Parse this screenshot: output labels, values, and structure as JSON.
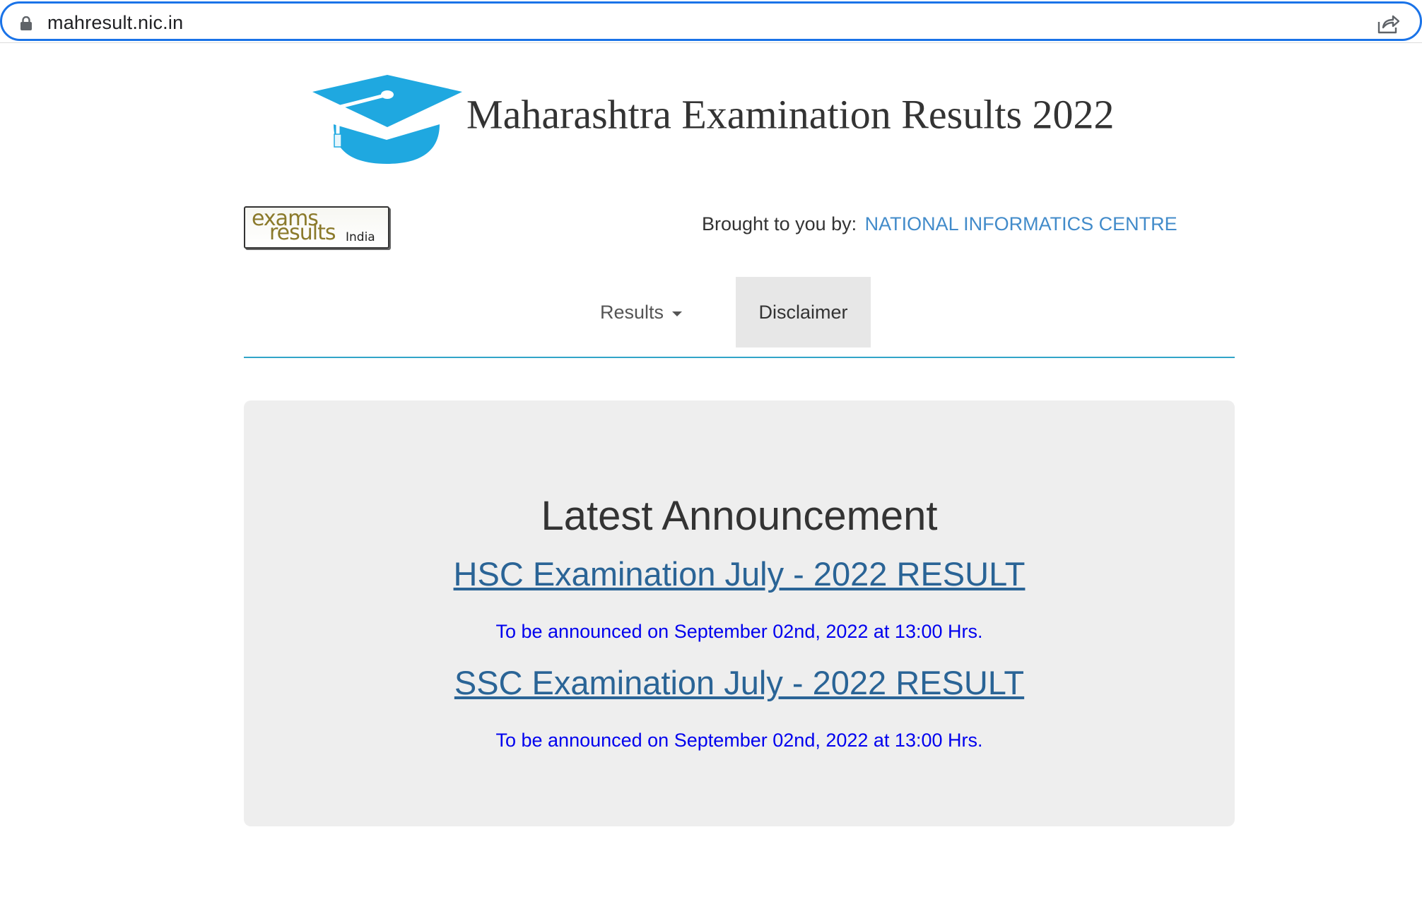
{
  "browser": {
    "url": "mahresult.nic.in"
  },
  "header": {
    "title": "Maharashtra Examination Results 2022"
  },
  "brand": {
    "logo_line1": "exams",
    "logo_line2": "results",
    "logo_line3": "India",
    "brought_label": "Brought to you by:",
    "org_name": "NATIONAL INFORMATICS CENTRE"
  },
  "nav": {
    "results_label": "Results",
    "disclaimer_label": "Disclaimer"
  },
  "announcement": {
    "title": "Latest Announcement",
    "items": [
      {
        "link": "HSC Examination July - 2022 RESULT",
        "note": "To be announced on September 02nd, 2022 at 13:00 Hrs."
      },
      {
        "link": "SSC Examination July - 2022 RESULT",
        "note": "To be announced on September 02nd, 2022 at 13:00 Hrs."
      }
    ]
  },
  "colors": {
    "accent": "#1a73e8",
    "link": "#2a6496",
    "org": "#428bca",
    "note": "#0000ee",
    "cap": "#1fa8e0"
  }
}
